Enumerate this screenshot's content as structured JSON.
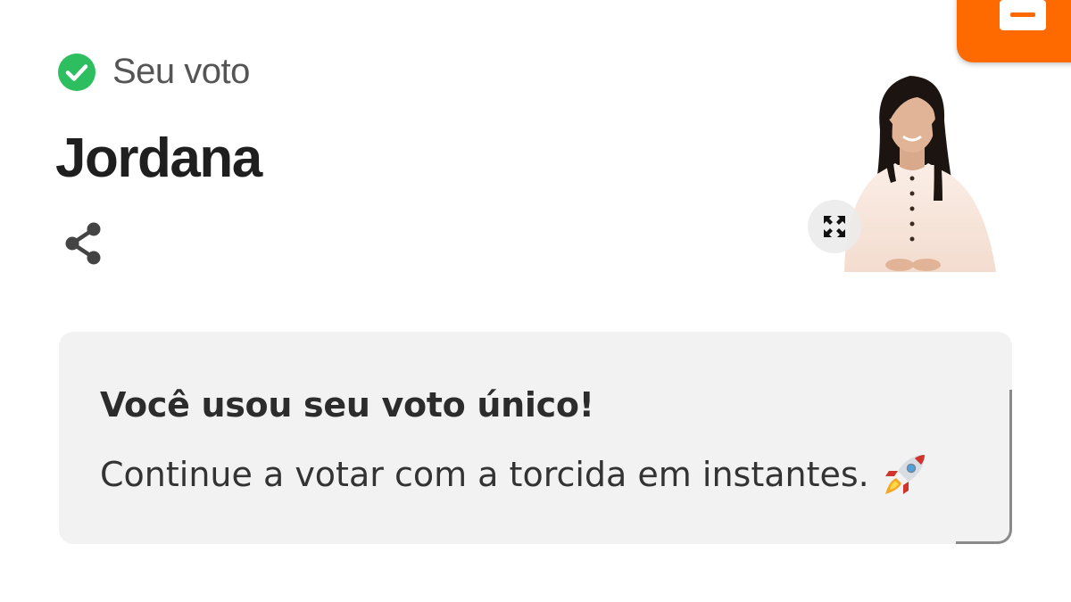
{
  "vote": {
    "label": "Seu voto",
    "candidate_name": "Jordana",
    "status_icon": "check-circle-icon",
    "status_color": "#2dbf5f"
  },
  "actions": {
    "share_icon": "share-icon",
    "expand_icon": "expand-icon",
    "fab_icon": "note-icon",
    "fab_color": "#ff6a00"
  },
  "notice": {
    "title": "Você usou seu voto único!",
    "message": "Continue a votar com a torcida em instantes.",
    "emoji_icon": "rocket-icon"
  }
}
